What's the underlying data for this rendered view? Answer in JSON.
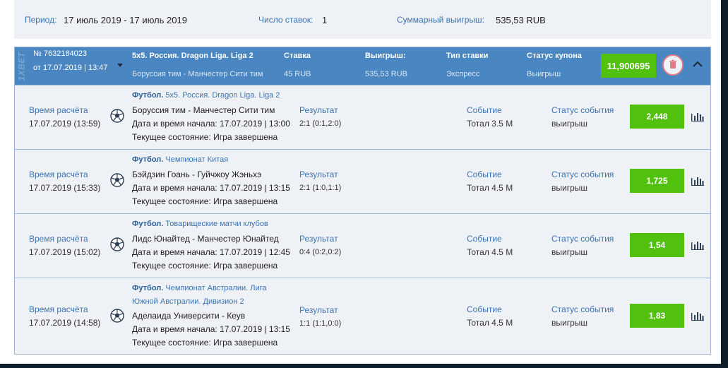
{
  "summary": {
    "period_label": "Период:",
    "period_value": "17 июль 2019 - 17 июль 2019",
    "bets_label": "Число ставок:",
    "bets_value": "1",
    "total_label": "Суммарный выигрыш:",
    "total_value": "535,53 RUB"
  },
  "coupon": {
    "brand": "1XBET",
    "number": "№ 7632184023",
    "date": "от 17.07.2019 | 13:47",
    "league_title": "5x5. Россия. Dragon Liga. Liga 2",
    "league_match": "Боруссия тим - Манчестер Сити тим",
    "stake_label": "Ставка",
    "stake_value": "45 RUB",
    "win_label": "Выигрыш:",
    "win_value": "535,53 RUB",
    "type_label": "Тип ставки",
    "type_value": "Экспресс",
    "status_label": "Статус купона",
    "status_value": "Выигрыш",
    "total_coef": "11,900695",
    "icons": {
      "trash": "trash-icon",
      "collapse": "chevron-up-icon",
      "expand": "caret-down-icon"
    },
    "accent_color": "#4a86c1",
    "odds_color": "#52c10d"
  },
  "rows": [
    {
      "calc_label": "Время расчёта",
      "calc_time": "17.07.2019 (13:59)",
      "sport": "Футбол.",
      "league": "5x5. Россия. Dragon Liga. Liga 2",
      "league_2": "",
      "match": "Боруссия тим - Манчестер Сити тим",
      "start": "Дата и время начала: 17.07.2019 | 13:00",
      "state": "Текущее состояние: Игра завершена",
      "result_label": "Результат",
      "result_value": "2:1 (0:1,2:0)",
      "event_label": "Событие",
      "event_value": "Тотал 3.5 М",
      "status_label": "Статус события",
      "status_value": "выигрыш",
      "odd": "2,448"
    },
    {
      "calc_label": "Время расчёта",
      "calc_time": "17.07.2019 (15:33)",
      "sport": "Футбол.",
      "league": "Чемпионат Китая",
      "league_2": "",
      "match": "Бэйдзин Гоань - Гуйчжоу Жэньхэ",
      "start": "Дата и время начала: 17.07.2019 | 13:15",
      "state": "Текущее состояние: Игра завершена",
      "result_label": "Результат",
      "result_value": "2:1 (1:0,1:1)",
      "event_label": "Событие",
      "event_value": "Тотал 4.5 М",
      "status_label": "Статус события",
      "status_value": "выигрыш",
      "odd": "1,725"
    },
    {
      "calc_label": "Время расчёта",
      "calc_time": "17.07.2019 (15:02)",
      "sport": "Футбол.",
      "league": "Товарищеские матчи клубов",
      "league_2": "",
      "match": "Лидс Юнайтед - Манчестер Юнайтед",
      "start": "Дата и время начала: 17.07.2019 | 12:45",
      "state": "Текущее состояние: Игра завершена",
      "result_label": "Результат",
      "result_value": "0:4 (0:2,0:2)",
      "event_label": "Событие",
      "event_value": "Тотал 4.5 М",
      "status_label": "Статус события",
      "status_value": "выигрыш",
      "odd": "1,54"
    },
    {
      "calc_label": "Время расчёта",
      "calc_time": "17.07.2019 (14:58)",
      "sport": "Футбол.",
      "league": "Чемпионат Австралии. Лига",
      "league_2": "Южной Австралии. Дивизион 2",
      "match": "Аделаида Университи - Кеув",
      "start": "Дата и время начала: 17.07.2019 | 13:15",
      "state": "Текущее состояние: Игра завершена",
      "result_label": "Результат",
      "result_value": "1:1 (1:1,0:0)",
      "event_label": "Событие",
      "event_value": "Тотал 4.5 М",
      "status_label": "Статус события",
      "status_value": "выигрыш",
      "odd": "1,83"
    }
  ]
}
